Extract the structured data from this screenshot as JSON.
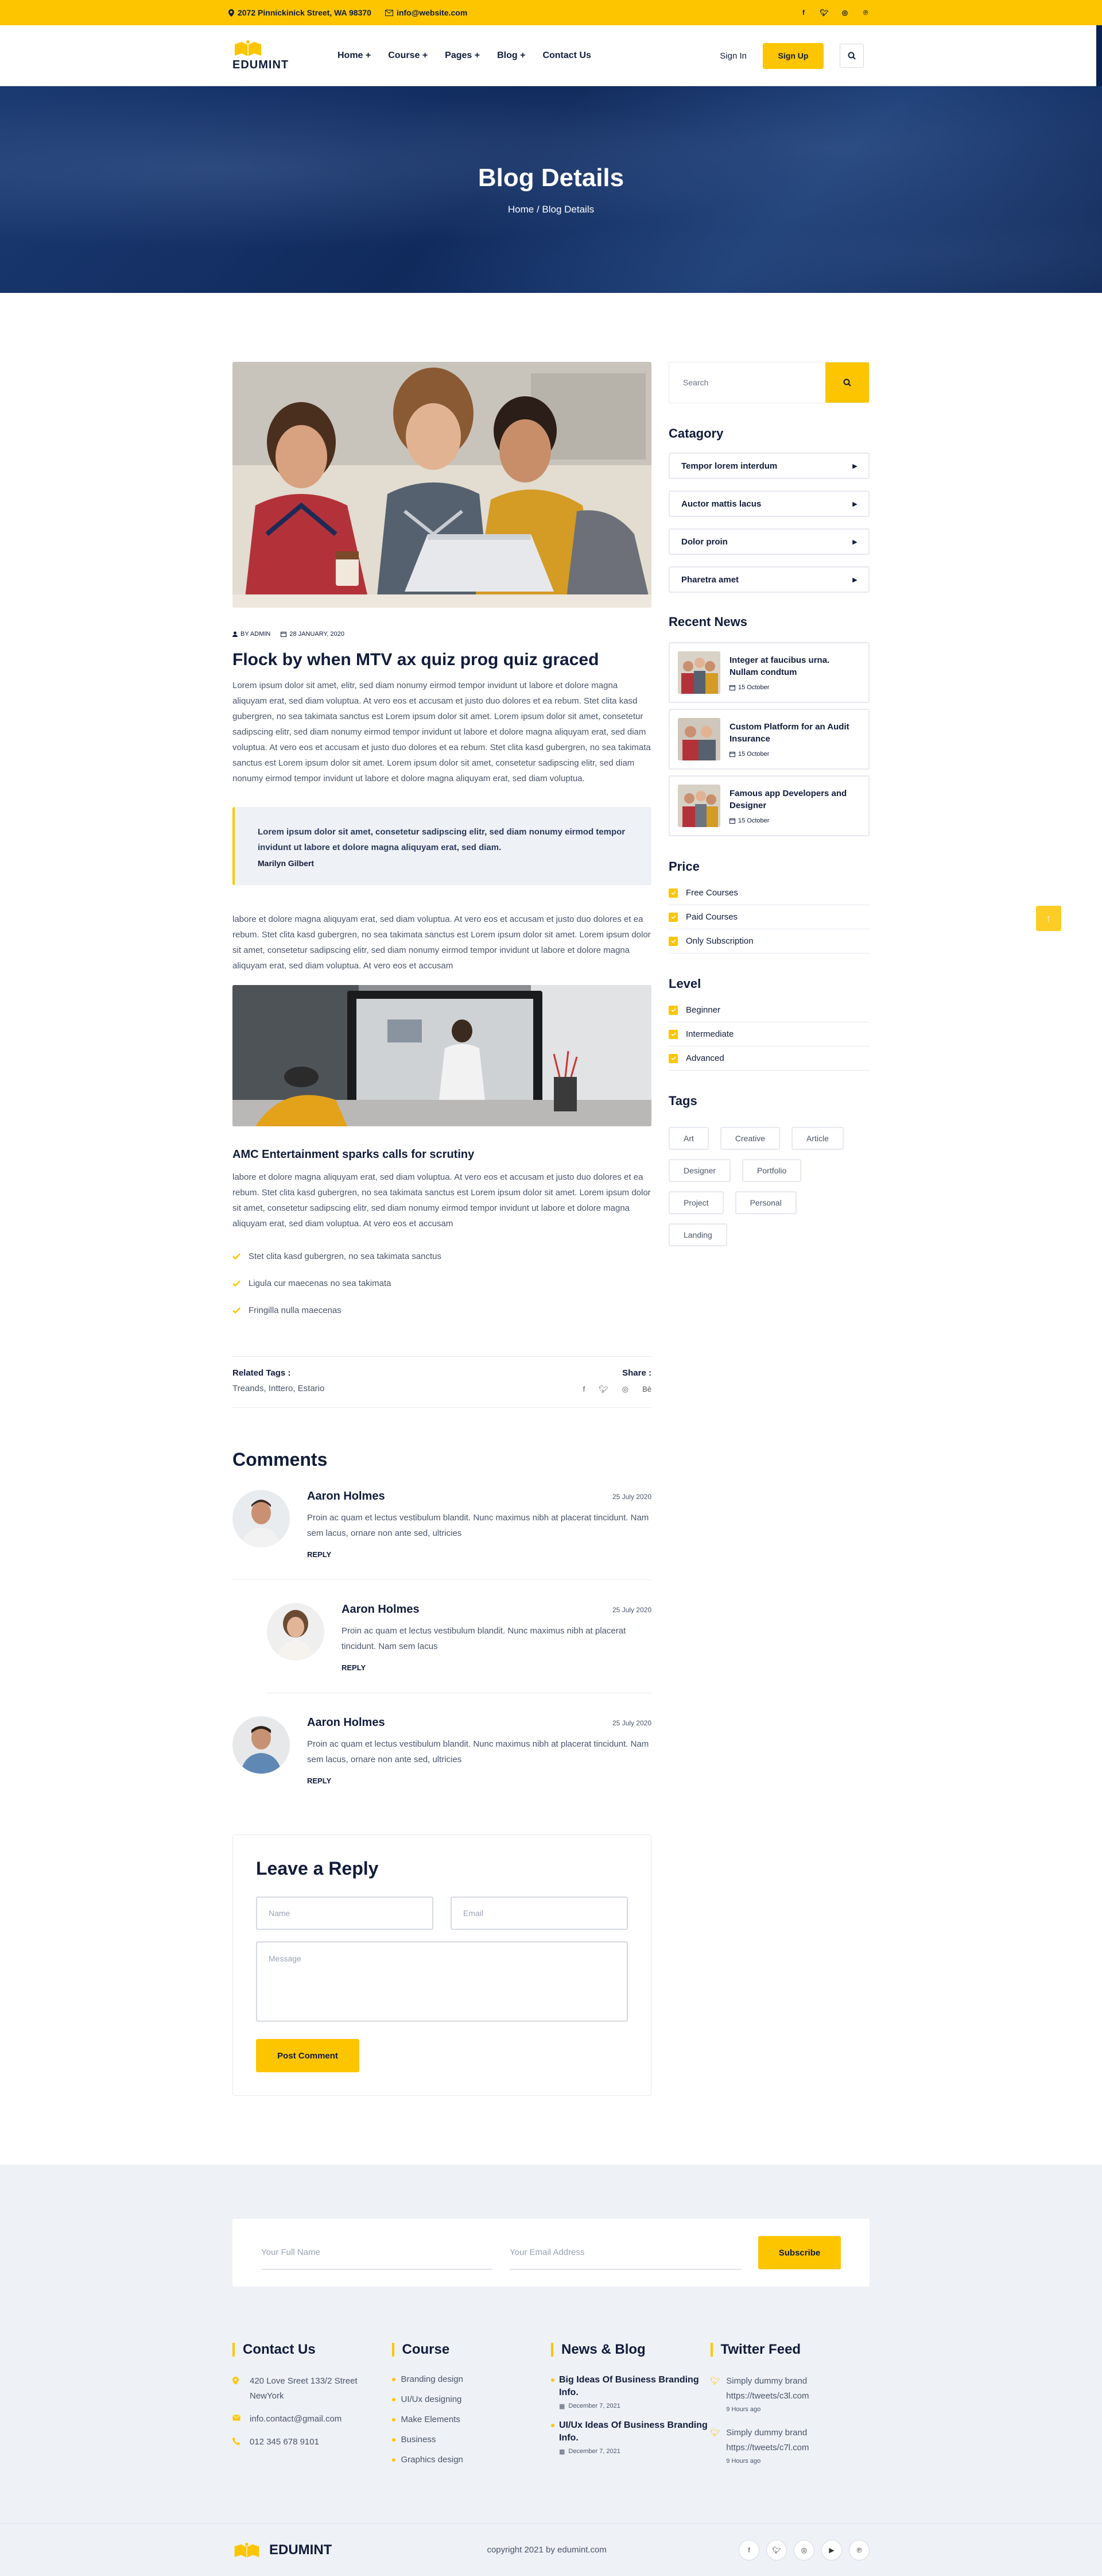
{
  "topbar": {
    "address": "2072 Pinnickinick Street, WA 98370",
    "email": "info@website.com",
    "social_icons": [
      "facebook-icon",
      "twitter-icon",
      "instagram-icon",
      "pinterest-icon"
    ]
  },
  "header": {
    "logo_text": "EDUMINT",
    "nav": [
      "Home +",
      "Course +",
      "Pages +",
      "Blog +",
      "Contact Us"
    ],
    "sign_in": "Sign In",
    "sign_up": "Sign Up"
  },
  "hero": {
    "title": "Blog Details",
    "breadcrumb": "Home / Blog Details"
  },
  "post": {
    "author": "BY ADMIN",
    "date": "28 JANUARY, 2020",
    "title": "Flock by when MTV ax quiz prog quiz graced",
    "para1": "Lorem ipsum dolor sit amet, elitr, sed diam nonumy eirmod tempor invidunt ut labore et dolore magna aliquyam erat, sed diam voluptua. At vero eos et accusam et justo duo dolores et ea rebum. Stet clita kasd gubergren, no sea takimata sanctus est Lorem ipsum dolor sit amet. Lorem ipsum dolor sit amet, consetetur sadipscing elitr, sed diam nonumy eirmod tempor invidunt ut labore et dolore magna aliquyam erat, sed diam voluptua. At vero eos et accusam et justo duo dolores et ea rebum. Stet clita kasd gubergren, no sea takimata sanctus est Lorem ipsum dolor sit amet. Lorem ipsum dolor sit amet, consetetur sadipscing elitr, sed diam nonumy eirmod tempor invidunt ut labore et dolore magna aliquyam erat, sed diam voluptua.",
    "quote": "Lorem ipsum dolor sit amet, consetetur sadipscing elitr, sed diam nonumy eirmod tempor invidunt ut labore et dolore magna aliquyam erat, sed diam.",
    "quote_author": "Marilyn Gilbert",
    "para2": "labore et dolore magna aliquyam erat, sed diam voluptua. At vero eos et accusam et justo duo dolores et ea rebum. Stet clita kasd gubergren, no sea takimata sanctus est Lorem ipsum dolor sit amet. Lorem ipsum dolor sit amet, consetetur sadipscing elitr, sed diam nonumy eirmod tempor invidunt ut labore et dolore magna aliquyam erat, sed diam voluptua. At vero eos et accusam",
    "subtitle": "AMC Entertainment sparks calls for scrutiny",
    "para3": "labore et dolore magna aliquyam erat, sed diam voluptua. At vero eos et accusam et justo duo dolores et ea rebum. Stet clita kasd gubergren, no sea takimata sanctus est Lorem ipsum dolor sit amet. Lorem ipsum dolor sit amet, consetetur sadipscing elitr, sed diam nonumy eirmod tempor invidunt ut labore et dolore magna aliquyam erat, sed diam voluptua. At vero eos et accusam",
    "checklist": [
      "Stet clita kasd gubergren, no sea takimata sanctus",
      "Ligula cur maecenas no sea takimata",
      "Fringilla nulla maecenas"
    ],
    "related_tags_label": "Related Tags :",
    "related_tags": "Treands, Inttero, Estario",
    "share_label": "Share :",
    "share_icons": [
      "facebook-icon",
      "twitter-icon",
      "instagram-icon",
      "behance-icon"
    ]
  },
  "comments": {
    "title": "Comments",
    "items": [
      {
        "name": "Aaron Holmes",
        "date": "25 July 2020",
        "text": "Proin ac quam et lectus vestibulum blandit. Nunc maximus nibh at placerat tincidunt. Nam sem lacus, ornare non ante sed, ultricies",
        "reply": "REPLY"
      },
      {
        "name": "Aaron Holmes",
        "date": "25 July 2020",
        "text": "Proin ac quam et lectus vestibulum blandit. Nunc maximus nibh at placerat tincidunt. Nam sem lacus",
        "reply": "REPLY"
      },
      {
        "name": "Aaron Holmes",
        "date": "25 July 2020",
        "text": "Proin ac quam et lectus vestibulum blandit. Nunc maximus nibh at placerat tincidunt. Nam sem lacus, ornare non ante sed, ultricies",
        "reply": "REPLY"
      }
    ]
  },
  "reply_form": {
    "title": "Leave a Reply",
    "name_ph": "Name",
    "email_ph": "Email",
    "message_ph": "Message",
    "button": "Post Comment"
  },
  "sidebar": {
    "search_ph": "Search",
    "category_title": "Catagory",
    "categories": [
      "Tempor lorem interdum",
      "Auctor mattis lacus",
      "Dolor proin",
      "Pharetra amet"
    ],
    "recent_title": "Recent News",
    "recent": [
      {
        "title": "Integer at faucibus urna. Nullam condtum",
        "date": "15 October"
      },
      {
        "title": "Custom Platform for an Audit Insurance",
        "date": "15 October"
      },
      {
        "title": "Famous app Developers and Designer",
        "date": "15 October"
      }
    ],
    "price_title": "Price",
    "price": [
      "Free Courses",
      "Paid Courses",
      "Only Subscription"
    ],
    "level_title": "Level",
    "level": [
      "Beginner",
      "Intermediate",
      "Advanced"
    ],
    "tags_title": "Tags",
    "tags": [
      "Art",
      "Creative",
      "Article",
      "Designer",
      "Portfolio",
      "Project",
      "Personal",
      "Landing"
    ]
  },
  "newsletter": {
    "name_ph": "Your Full Name",
    "email_ph": "Your Email Address",
    "button": "Subscribe"
  },
  "footer": {
    "contact_title": "Contact Us",
    "address": "420 Love Sreet 133/2 Street NewYork",
    "email": "info.contact@gmail.com",
    "phone": "012 345 678 9101",
    "course_title": "Course",
    "courses": [
      "Branding design",
      "UI/Ux designing",
      "Make Elements",
      "Business",
      "Graphics design"
    ],
    "news_title": "News & Blog",
    "news": [
      {
        "title": "Big Ideas Of Business Branding Info.",
        "date": "December 7, 2021"
      },
      {
        "title": "UI/Ux Ideas Of Business Branding Info.",
        "date": "December 7, 2021"
      }
    ],
    "twitter_title": "Twitter Feed",
    "tweets": [
      {
        "text": "Simply dummy brand https://tweets/c3l.com",
        "time": "9 Hours ago"
      },
      {
        "text": "Simply dummy brand https://tweets/c7l.com",
        "time": "9 Hours ago"
      }
    ],
    "logo_text": "EDUMINT",
    "copyright": "copyright 2021 by edumint.com",
    "social_icons": [
      "facebook-icon",
      "twitter-icon",
      "instagram-icon",
      "youtube-icon",
      "pinterest-icon"
    ]
  },
  "colors": {
    "accent": "#fdc500",
    "navy": "#111c3a",
    "hero": "#102a5c"
  }
}
